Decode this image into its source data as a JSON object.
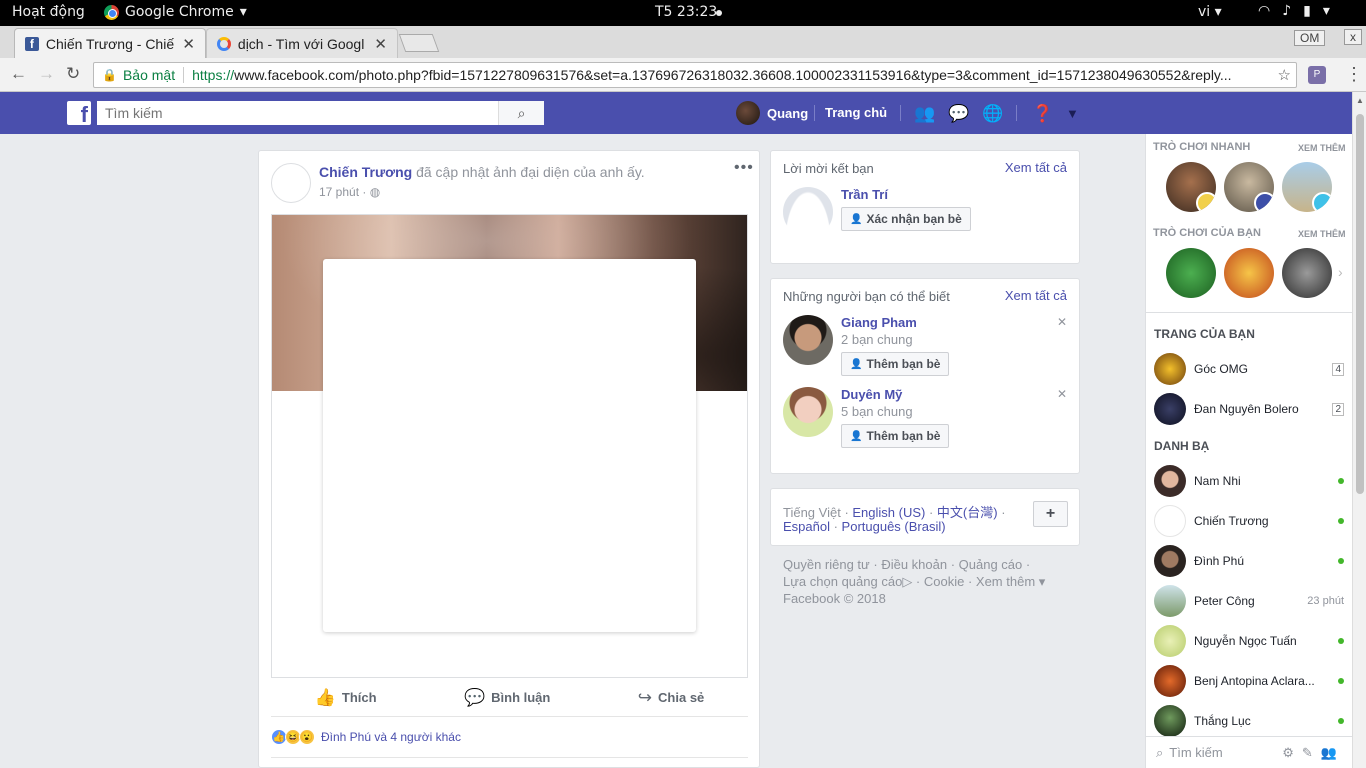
{
  "gnome": {
    "activities": "Hoạt động",
    "app_name": "Google Chrome",
    "clock": "T5 23:23",
    "lang": "vi"
  },
  "tabs": [
    {
      "title": "Chiến Trương - Chiế",
      "active": true
    },
    {
      "title": "dịch - Tìm với Googl",
      "active": false
    }
  ],
  "window": {
    "om_label": "OM",
    "close_label": "x"
  },
  "address": {
    "secure_label": "Bảo mật",
    "url_scheme": "https://",
    "url_rest": "www.facebook.com/photo.php?fbid=1571227809631576&set=a.137696726318032.36608.100002331153916&type=3&comment_id=1571238049630552&reply..."
  },
  "fb_header": {
    "search_placeholder": "Tìm kiếm",
    "user_name": "Quang",
    "home_label": "Trang chủ",
    "brand_color": "#4a4fad"
  },
  "post": {
    "author": "Chiến Trương",
    "action_text": "đã cập nhật ảnh đại diện của anh ấy.",
    "time": "17 phút",
    "like_label": "Thích",
    "comment_label": "Bình luận",
    "share_label": "Chia sẻ",
    "reactions_text": "Đình Phú và 4 người khác"
  },
  "friend_requests": {
    "title": "Lời mời kết bạn",
    "see_all": "Xem tất cả",
    "items": [
      {
        "name": "Trần Trí",
        "button": "Xác nhận bạn bè"
      }
    ]
  },
  "people_you_may_know": {
    "title": "Những người bạn có thể biết",
    "see_all": "Xem tất cả",
    "items": [
      {
        "name": "Giang Pham",
        "mutual": "2 bạn chung",
        "button": "Thêm bạn bè"
      },
      {
        "name": "Duyên Mỹ",
        "mutual": "5 bạn chung",
        "button": "Thêm bạn bè"
      }
    ]
  },
  "languages": {
    "current": "Tiếng Việt",
    "options": [
      "English (US)",
      "中文(台灣)",
      "Español",
      "Português (Brasil)"
    ]
  },
  "footer": {
    "links": [
      "Quyền riêng tư",
      "Điều khoản",
      "Quảng cáo",
      "Lựa chọn quảng cáo",
      "Cookie",
      "Xem thêm"
    ],
    "copyright": "Facebook © 2018"
  },
  "sidebar": {
    "quick_games_title": "TRÒ CHƠI NHANH",
    "your_games_title": "TRÒ CHƠI CỦA BẠN",
    "see_more": "XEM THÊM",
    "pages_title": "TRANG CỦA BẠN",
    "pages": [
      {
        "name": "Góc OMG",
        "count": "4"
      },
      {
        "name": "Đan Nguyên Bolero",
        "count": "2"
      }
    ],
    "contacts_title": "DANH BẠ",
    "contacts": [
      {
        "name": "Nam Nhi",
        "status": "online"
      },
      {
        "name": "Chiến Trương",
        "status": "online"
      },
      {
        "name": "Đình Phú",
        "status": "online"
      },
      {
        "name": "Peter Công",
        "status": "23 phút"
      },
      {
        "name": "Nguyễn Ngọc Tuấn",
        "status": "online"
      },
      {
        "name": "Benj Antopina Aclara...",
        "status": "online"
      },
      {
        "name": "Thắng Lục",
        "status": "online"
      }
    ],
    "chat_search_placeholder": "Tìm kiếm"
  }
}
